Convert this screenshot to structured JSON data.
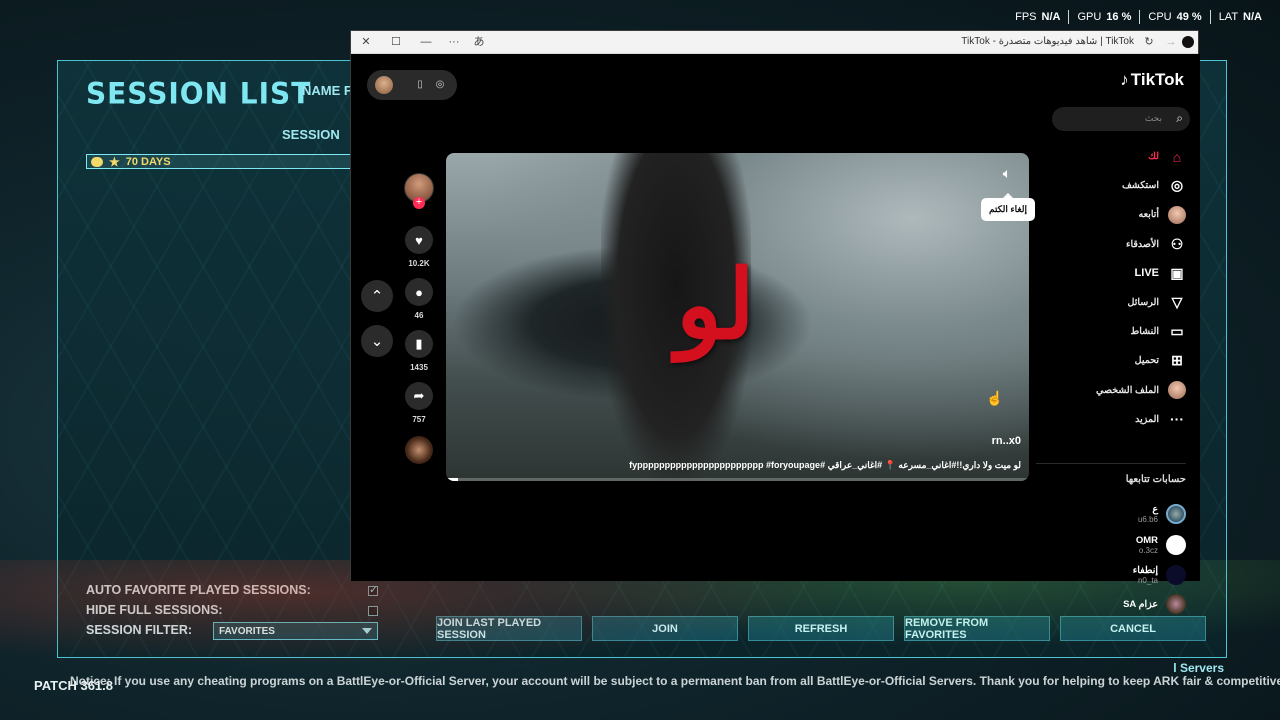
{
  "perf": [
    {
      "label": "FPS",
      "value": "N/A"
    },
    {
      "label": "GPU",
      "value": "16 %"
    },
    {
      "label": "CPU",
      "value": "49 %"
    },
    {
      "label": "LAT",
      "value": "N/A"
    }
  ],
  "ark": {
    "title": "SESSION LIST",
    "name_filter_label": "NAME FI",
    "session_column": "SESSION",
    "session_row": "70 DAYS",
    "options": {
      "auto_favorite": "AUTO FAVORITE PLAYED SESSIONS:",
      "hide_full": "HIDE FULL SESSIONS:",
      "filter_label": "SESSION FILTER:",
      "filter_value": "FAVORITES",
      "auto_favorite_checked": true,
      "hide_full_checked": false
    },
    "buttons": {
      "join_last": "JOIN LAST PLAYED SESSION",
      "join": "JOIN",
      "refresh": "REFRESH",
      "remove_fav": "REMOVE FROM FAVORITES",
      "cancel": "CANCEL"
    },
    "servers_label": "l Servers",
    "patch": "PATCH 361.8",
    "notice": "Notice: If you use any cheating programs on a BattlEye-or-Official Server, your account will be subject to a permanent ban from all BattlEye-or-Official Servers. Thank you for helping to keep ARK fair & competitive!"
  },
  "browser": {
    "title": "TikTok | شاهد فيديوهات متصدرة - TikTok"
  },
  "tiktok": {
    "logo": "TikTok",
    "search_placeholder": "بحث",
    "nav": [
      {
        "label": "لك",
        "icon": "home-icon"
      },
      {
        "label": "استكشف",
        "icon": "compass-icon"
      },
      {
        "label": "أتابعه",
        "icon": "avatar"
      },
      {
        "label": "الأصدقاء",
        "icon": "friends-icon"
      },
      {
        "label": "LIVE",
        "icon": "live-icon"
      },
      {
        "label": "الرسائل",
        "icon": "send-icon"
      },
      {
        "label": "النشاط",
        "icon": "activity-icon"
      },
      {
        "label": "تحميل",
        "icon": "upload-icon"
      },
      {
        "label": "الملف الشخصي",
        "icon": "avatar"
      },
      {
        "label": "المزيد",
        "icon": "more-icon"
      }
    ],
    "following_title": "حسابات تتابعها",
    "following": [
      {
        "name": "ع",
        "handle": "u6.b6"
      },
      {
        "name": "OMR",
        "handle": "o.3cz"
      },
      {
        "name": "إنطفاء",
        "handle": "n0_ta"
      },
      {
        "name": "SA عزام",
        "handle": ""
      }
    ],
    "video": {
      "overlay_word": "لو",
      "author": "rn..x0",
      "caption": "لو ميت ولا داري!!#اغاني_مسرعه 📍 #اغاني_عراقي #fyppppppppppppppppppppppp #foryoupage",
      "tooltip": "إلغاء الكتم",
      "progress": 0.02
    },
    "actions": {
      "likes": "10.2K",
      "comments": "46",
      "saves": "1435",
      "shares": "757"
    }
  }
}
